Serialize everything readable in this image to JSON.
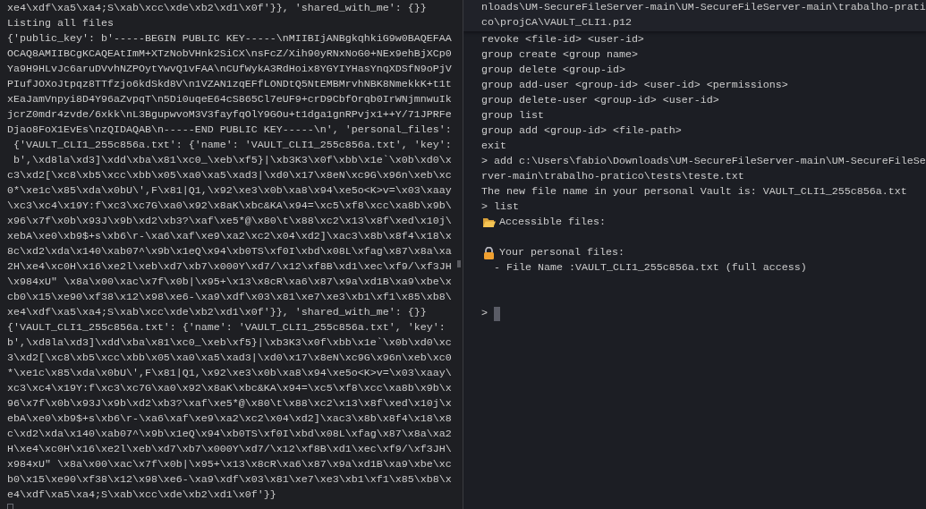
{
  "left_pane": {
    "lines": [
      "xe4\\xdf\\xa5\\xa4;S\\xab\\xcc\\xde\\xb2\\xd1\\x0f'}}, 'shared_with_me': {}}",
      "Listing all files",
      "{'public_key': b'-----BEGIN PUBLIC KEY-----\\nMIIBIjANBgkqhkiG9w0BAQEFAA",
      "OCAQ8AMIIBCgKCAQEAtImM+XTzNobVHnk2SiCX\\nsFcZ/Xih90yRNxNoG0+NEx9ehBjXCp0",
      "Ya9H9HLvJc6aruDVvhNZPOytYwvQ1vFAA\\nCUfWykA3RdHoix8YGYIYHasYnqXDSfN9oPjV",
      "PIufJOXoJtpqz8TTfzjo6kdSkd8V\\n1VZAN1zqEFfLONDtQ5NtEMBMrvhNBK8NmekkK+t1t",
      "xEaJamVnpyi8D4Y96aZvpqT\\n5Di0uqeE64cS865Cl7eUF9+crD9CbfOrqb0IrWNjmnwuIk",
      "jcrZ0mdr4zvde/6xkk\\nL3BgupwvoM3V3fayfqOlY9GOu+t1dga1gnRPvjx1++Y/71JPRFe",
      "Djao8FoX1EvEs\\nzQIDAQAB\\n-----END PUBLIC KEY-----\\n', 'personal_files':",
      " {'VAULT_CLI1_255c856a.txt': {'name': 'VAULT_CLI1_255c856a.txt', 'key':",
      " b',\\xd8la\\xd3]\\xdd\\xba\\x81\\xc0_\\xeb\\xf5}|\\xb3K3\\x0f\\xbb\\x1e`\\x0b\\xd0\\x",
      "c3\\xd2[\\xc8\\xb5\\xcc\\xbb\\x05\\xa0\\xa5\\xad3|\\xd0\\x17\\x8eN\\xc9G\\x96n\\xeb\\xc",
      "0*\\xe1c\\x85\\xda\\x0bU\\',F\\x81|Q1,\\x92\\xe3\\x0b\\xa8\\x94\\xe5o<K>v=\\x03\\xaay",
      "\\xc3\\xc4\\x19Y:f\\xc3\\xc7G\\xa0\\x92\\x8aK\\xbc&KA\\x94=\\xc5\\xf8\\xcc\\xa8b\\x9b\\",
      "x96\\x7f\\x0b\\x93J\\x9b\\xd2\\xb3?\\xaf\\xe5*@\\x80\\t\\x88\\xc2\\x13\\x8f\\xed\\x10j\\",
      "xebA\\xe0\\xb9$+s\\xb6\\r-\\xa6\\xaf\\xe9\\xa2\\xc2\\x04\\xd2]\\xac3\\x8b\\x8f4\\x18\\x",
      "8c\\xd2\\xda\\x140\\xab07^\\x9b\\x1eQ\\x94\\xb0TS\\xf0I\\xbd\\x08L\\xfag\\x87\\x8a\\xa",
      "2H\\xe4\\xc0H\\x16\\xe2l\\xeb\\xd7\\xb7\\x000Y\\xd7/\\x12\\xf8B\\xd1\\xec\\xf9/\\xf3JH",
      "\\x984xU\" \\x8a\\x00\\xac\\x7f\\x0b|\\x95+\\x13\\x8cR\\xa6\\x87\\x9a\\xd1B\\xa9\\xbe\\x",
      "cb0\\x15\\xe90\\xf38\\x12\\x98\\xe6-\\xa9\\xdf\\x03\\x81\\xe7\\xe3\\xb1\\xf1\\x85\\xb8\\",
      "xe4\\xdf\\xa5\\xa4;S\\xab\\xcc\\xde\\xb2\\xd1\\x0f'}}, 'shared_with_me': {}}",
      "{'VAULT_CLI1_255c856a.txt': {'name': 'VAULT_CLI1_255c856a.txt', 'key':",
      "b',\\xd8la\\xd3]\\xdd\\xba\\x81\\xc0_\\xeb\\xf5}|\\xb3K3\\x0f\\xbb\\x1e`\\x0b\\xd0\\xc",
      "3\\xd2[\\xc8\\xb5\\xcc\\xbb\\x05\\xa0\\xa5\\xad3|\\xd0\\x17\\x8eN\\xc9G\\x96n\\xeb\\xc0",
      "*\\xe1c\\x85\\xda\\x0bU\\',F\\x81|Q1,\\x92\\xe3\\x0b\\xa8\\x94\\xe5o<K>v=\\x03\\xaay\\",
      "xc3\\xc4\\x19Y:f\\xc3\\xc7G\\xa0\\x92\\x8aK\\xbc&KA\\x94=\\xc5\\xf8\\xcc\\xa8b\\x9b\\x",
      "96\\x7f\\x0b\\x93J\\x9b\\xd2\\xb3?\\xaf\\xe5*@\\x80\\t\\x88\\xc2\\x13\\x8f\\xed\\x10j\\x",
      "ebA\\xe0\\xb9$+s\\xb6\\r-\\xa6\\xaf\\xe9\\xa2\\xc2\\x04\\xd2]\\xac3\\x8b\\x8f4\\x18\\x8",
      "c\\xd2\\xda\\x140\\xab07^\\x9b\\x1eQ\\x94\\xb0TS\\xf0I\\xbd\\x08L\\xfag\\x87\\x8a\\xa2",
      "H\\xe4\\xc0H\\x16\\xe2l\\xeb\\xd7\\xb7\\x000Y\\xd7/\\x12\\xf8B\\xd1\\xec\\xf9/\\xf3JH\\",
      "x984xU\" \\x8a\\x00\\xac\\x7f\\x0b|\\x95+\\x13\\x8cR\\xa6\\x87\\x9a\\xd1B\\xa9\\xbe\\xc",
      "b0\\x15\\xe90\\xf38\\x12\\x98\\xe6-\\xa9\\xdf\\x03\\x81\\xe7\\xe3\\xb1\\xf1\\x85\\xb8\\x",
      "e4\\xdf\\xa5\\xa4;S\\xab\\xcc\\xde\\xb2\\xd1\\x0f'}}"
    ],
    "cursor": {
      "focused": false
    }
  },
  "right_pane": {
    "sticky_header": [
      "nloads\\UM-SecureFileServer-main\\UM-SecureFileServer-main\\trabalho-prati",
      "co\\projCA\\VAULT_CLI1.p12"
    ],
    "lines": [
      {
        "kind": "text",
        "text": "revoke <file-id> <user-id>"
      },
      {
        "kind": "text",
        "text": "group create <group name>"
      },
      {
        "kind": "text",
        "text": "group delete <group-id>"
      },
      {
        "kind": "text",
        "text": "group add-user <group-id> <user-id> <permissions>"
      },
      {
        "kind": "text",
        "text": "group delete-user <group-id> <user-id>"
      },
      {
        "kind": "text",
        "text": "group list"
      },
      {
        "kind": "text",
        "text": "group add <group-id> <file-path>"
      },
      {
        "kind": "text",
        "text": "exit"
      },
      {
        "kind": "text",
        "text": "> add c:\\Users\\fabio\\Downloads\\UM-SecureFileServer-main\\UM-SecureFileSe"
      },
      {
        "kind": "text",
        "text": "rver-main\\trabalho-pratico\\tests\\teste.txt"
      },
      {
        "kind": "text",
        "text": "The new file name in your personal Vault is: VAULT_CLI1_255c856a.txt"
      },
      {
        "kind": "text",
        "text": "> list"
      },
      {
        "kind": "folder",
        "text": "Accessible files:"
      },
      {
        "kind": "gap"
      },
      {
        "kind": "lock",
        "text": "Your personal files:"
      },
      {
        "kind": "text",
        "text": "  - File Name :VAULT_CLI1_255c856a.txt (full access)"
      },
      {
        "kind": "gap"
      },
      {
        "kind": "gap"
      },
      {
        "kind": "prompt",
        "text": ">",
        "cursor": {
          "focused": true
        }
      }
    ]
  }
}
